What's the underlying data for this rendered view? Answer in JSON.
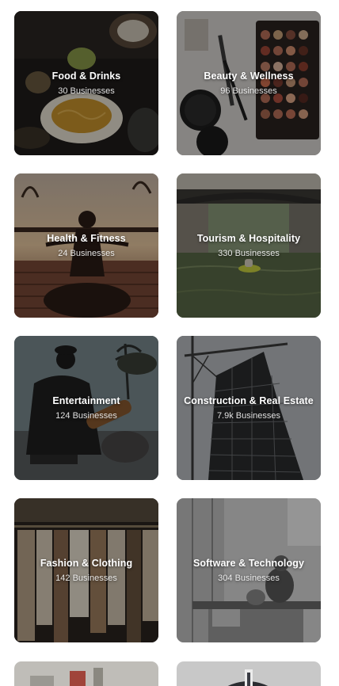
{
  "categories": [
    {
      "title": "Food & Drinks",
      "count": "30 Businesses",
      "image": "food-photo"
    },
    {
      "title": "Beauty & Wellness",
      "count": "96 Businesses",
      "image": "makeup-photo"
    },
    {
      "title": "Health & Fitness",
      "count": "24 Businesses",
      "image": "yoga-photo"
    },
    {
      "title": "Tourism & Hospitality",
      "count": "330 Businesses",
      "image": "canal-boat-photo"
    },
    {
      "title": "Entertainment",
      "count": "124 Businesses",
      "image": "musician-photo"
    },
    {
      "title": "Construction & Real Estate",
      "count": "7.9k Businesses",
      "image": "building-crane-photo"
    },
    {
      "title": "Fashion & Clothing",
      "count": "142 Businesses",
      "image": "clothing-rack-photo"
    },
    {
      "title": "Software & Technology",
      "count": "304 Businesses",
      "image": "office-laptop-photo"
    }
  ],
  "partial_cards": [
    {
      "image": "storefront-photo"
    },
    {
      "image": "businessman-photo"
    }
  ]
}
